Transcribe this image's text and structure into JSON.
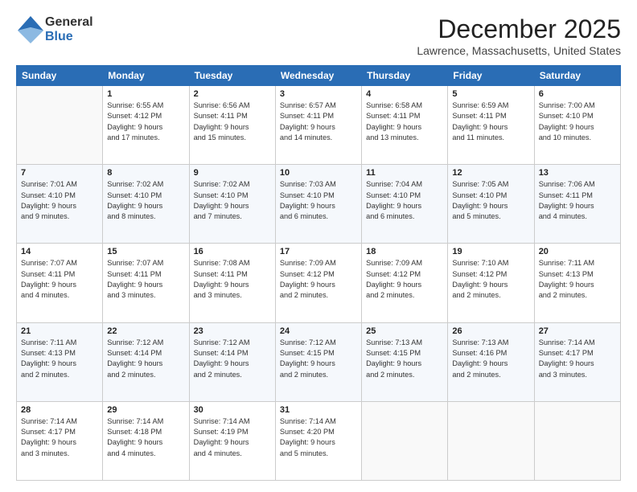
{
  "logo": {
    "general": "General",
    "blue": "Blue"
  },
  "header": {
    "month": "December 2025",
    "location": "Lawrence, Massachusetts, United States"
  },
  "weekdays": [
    "Sunday",
    "Monday",
    "Tuesday",
    "Wednesday",
    "Thursday",
    "Friday",
    "Saturday"
  ],
  "weeks": [
    [
      {
        "day": "",
        "info": ""
      },
      {
        "day": "1",
        "info": "Sunrise: 6:55 AM\nSunset: 4:12 PM\nDaylight: 9 hours\nand 17 minutes."
      },
      {
        "day": "2",
        "info": "Sunrise: 6:56 AM\nSunset: 4:11 PM\nDaylight: 9 hours\nand 15 minutes."
      },
      {
        "day": "3",
        "info": "Sunrise: 6:57 AM\nSunset: 4:11 PM\nDaylight: 9 hours\nand 14 minutes."
      },
      {
        "day": "4",
        "info": "Sunrise: 6:58 AM\nSunset: 4:11 PM\nDaylight: 9 hours\nand 13 minutes."
      },
      {
        "day": "5",
        "info": "Sunrise: 6:59 AM\nSunset: 4:11 PM\nDaylight: 9 hours\nand 11 minutes."
      },
      {
        "day": "6",
        "info": "Sunrise: 7:00 AM\nSunset: 4:10 PM\nDaylight: 9 hours\nand 10 minutes."
      }
    ],
    [
      {
        "day": "7",
        "info": "Sunrise: 7:01 AM\nSunset: 4:10 PM\nDaylight: 9 hours\nand 9 minutes."
      },
      {
        "day": "8",
        "info": "Sunrise: 7:02 AM\nSunset: 4:10 PM\nDaylight: 9 hours\nand 8 minutes."
      },
      {
        "day": "9",
        "info": "Sunrise: 7:02 AM\nSunset: 4:10 PM\nDaylight: 9 hours\nand 7 minutes."
      },
      {
        "day": "10",
        "info": "Sunrise: 7:03 AM\nSunset: 4:10 PM\nDaylight: 9 hours\nand 6 minutes."
      },
      {
        "day": "11",
        "info": "Sunrise: 7:04 AM\nSunset: 4:10 PM\nDaylight: 9 hours\nand 6 minutes."
      },
      {
        "day": "12",
        "info": "Sunrise: 7:05 AM\nSunset: 4:10 PM\nDaylight: 9 hours\nand 5 minutes."
      },
      {
        "day": "13",
        "info": "Sunrise: 7:06 AM\nSunset: 4:11 PM\nDaylight: 9 hours\nand 4 minutes."
      }
    ],
    [
      {
        "day": "14",
        "info": "Sunrise: 7:07 AM\nSunset: 4:11 PM\nDaylight: 9 hours\nand 4 minutes."
      },
      {
        "day": "15",
        "info": "Sunrise: 7:07 AM\nSunset: 4:11 PM\nDaylight: 9 hours\nand 3 minutes."
      },
      {
        "day": "16",
        "info": "Sunrise: 7:08 AM\nSunset: 4:11 PM\nDaylight: 9 hours\nand 3 minutes."
      },
      {
        "day": "17",
        "info": "Sunrise: 7:09 AM\nSunset: 4:12 PM\nDaylight: 9 hours\nand 2 minutes."
      },
      {
        "day": "18",
        "info": "Sunrise: 7:09 AM\nSunset: 4:12 PM\nDaylight: 9 hours\nand 2 minutes."
      },
      {
        "day": "19",
        "info": "Sunrise: 7:10 AM\nSunset: 4:12 PM\nDaylight: 9 hours\nand 2 minutes."
      },
      {
        "day": "20",
        "info": "Sunrise: 7:11 AM\nSunset: 4:13 PM\nDaylight: 9 hours\nand 2 minutes."
      }
    ],
    [
      {
        "day": "21",
        "info": "Sunrise: 7:11 AM\nSunset: 4:13 PM\nDaylight: 9 hours\nand 2 minutes."
      },
      {
        "day": "22",
        "info": "Sunrise: 7:12 AM\nSunset: 4:14 PM\nDaylight: 9 hours\nand 2 minutes."
      },
      {
        "day": "23",
        "info": "Sunrise: 7:12 AM\nSunset: 4:14 PM\nDaylight: 9 hours\nand 2 minutes."
      },
      {
        "day": "24",
        "info": "Sunrise: 7:12 AM\nSunset: 4:15 PM\nDaylight: 9 hours\nand 2 minutes."
      },
      {
        "day": "25",
        "info": "Sunrise: 7:13 AM\nSunset: 4:15 PM\nDaylight: 9 hours\nand 2 minutes."
      },
      {
        "day": "26",
        "info": "Sunrise: 7:13 AM\nSunset: 4:16 PM\nDaylight: 9 hours\nand 2 minutes."
      },
      {
        "day": "27",
        "info": "Sunrise: 7:14 AM\nSunset: 4:17 PM\nDaylight: 9 hours\nand 3 minutes."
      }
    ],
    [
      {
        "day": "28",
        "info": "Sunrise: 7:14 AM\nSunset: 4:17 PM\nDaylight: 9 hours\nand 3 minutes."
      },
      {
        "day": "29",
        "info": "Sunrise: 7:14 AM\nSunset: 4:18 PM\nDaylight: 9 hours\nand 4 minutes."
      },
      {
        "day": "30",
        "info": "Sunrise: 7:14 AM\nSunset: 4:19 PM\nDaylight: 9 hours\nand 4 minutes."
      },
      {
        "day": "31",
        "info": "Sunrise: 7:14 AM\nSunset: 4:20 PM\nDaylight: 9 hours\nand 5 minutes."
      },
      {
        "day": "",
        "info": ""
      },
      {
        "day": "",
        "info": ""
      },
      {
        "day": "",
        "info": ""
      }
    ]
  ]
}
